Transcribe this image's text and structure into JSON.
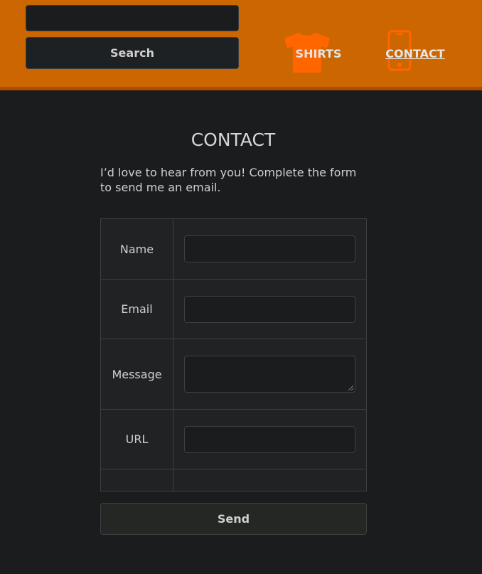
{
  "header": {
    "search": {
      "placeholder": "",
      "value": "",
      "button_label": "Search"
    },
    "nav": [
      {
        "label": "SHIRTS",
        "icon": "tshirt-icon",
        "active": false
      },
      {
        "label": "CONTACT",
        "icon": "phone-icon",
        "active": true
      }
    ]
  },
  "main": {
    "title": "CONTACT",
    "intro": "I’d love to hear from you! Complete the form to send me an email.",
    "form": {
      "fields": [
        {
          "label": "Name",
          "value": ""
        },
        {
          "label": "Email",
          "value": ""
        },
        {
          "label": "Message",
          "value": ""
        },
        {
          "label": "URL",
          "value": ""
        }
      ],
      "submit_label": "Send"
    }
  },
  "colors": {
    "header_bg": "#cc6600",
    "header_border": "#b34a00",
    "icon_accent": "#ff6600",
    "page_bg": "#1b1c1e"
  }
}
